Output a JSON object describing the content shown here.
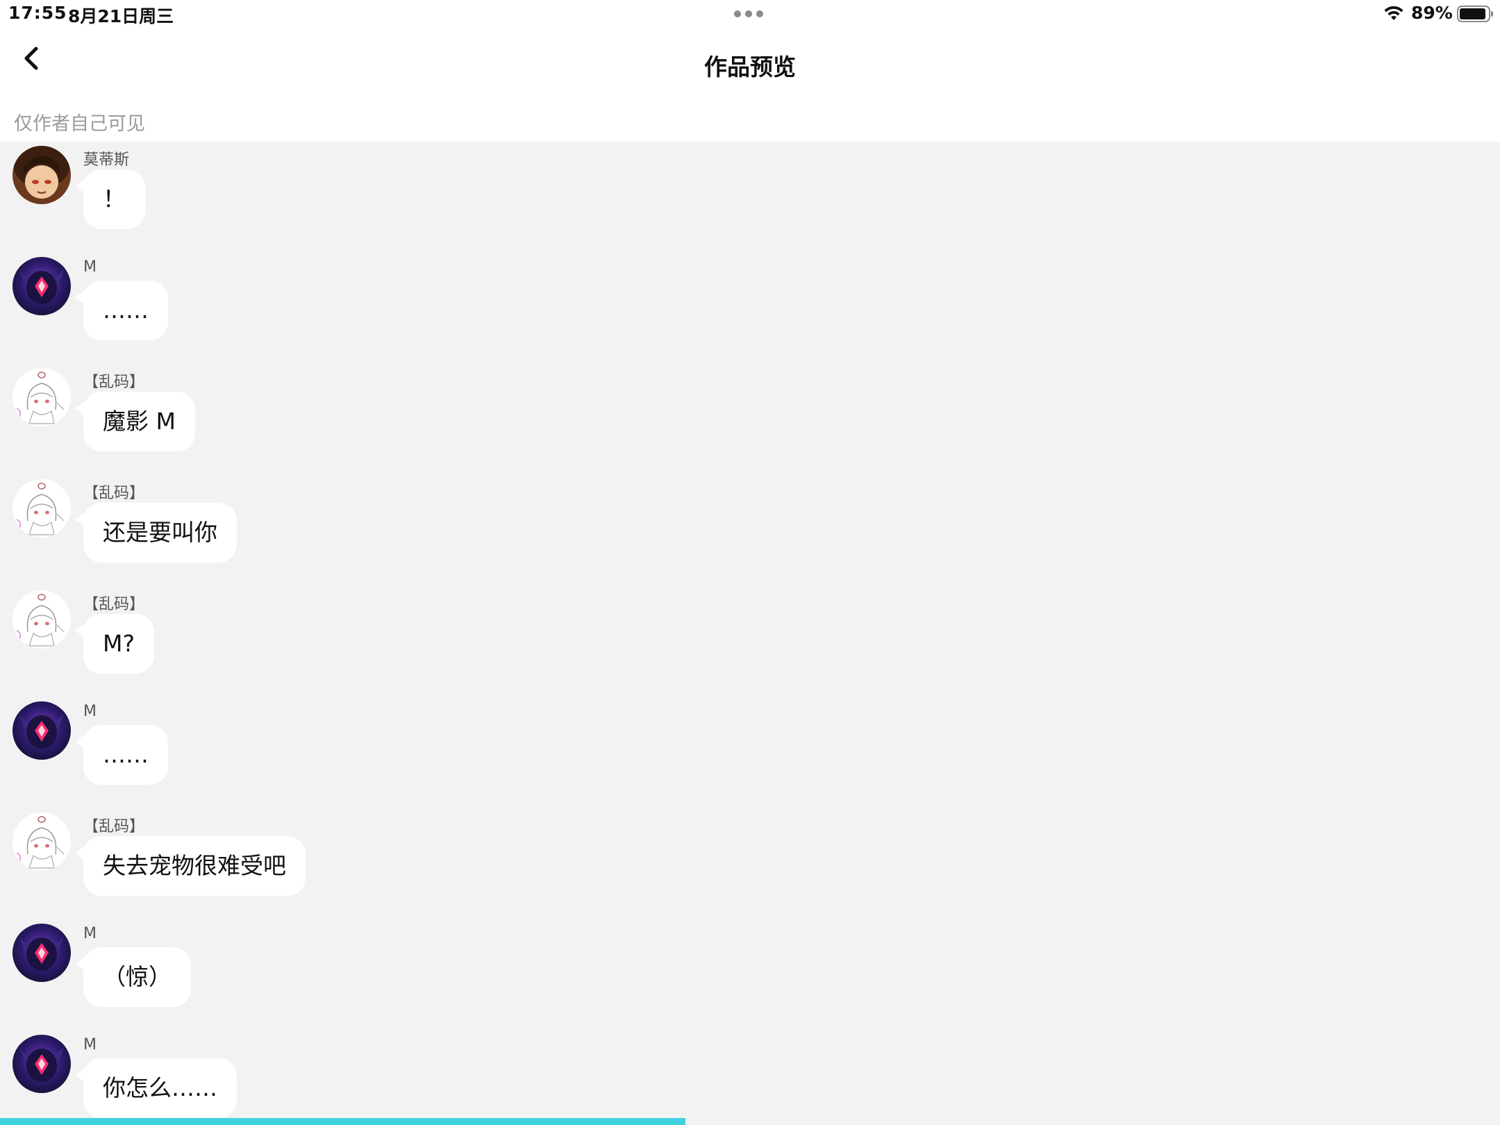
{
  "status_bar": {
    "time": "17:55",
    "date": "8月21日周三",
    "battery": "89%",
    "wifi_icon": "wifi-icon",
    "battery_icon": "battery-icon"
  },
  "nav": {
    "back_icon": "chevron-left-icon",
    "title": "作品预览"
  },
  "visibility_note": "仅作者自己可见",
  "messages": [
    {
      "sender": "莫蒂斯",
      "text": "！",
      "avatar": "mortis"
    },
    {
      "sender": "M",
      "text": "……",
      "avatar": "m"
    },
    {
      "sender": "【乱码】",
      "text": "魔影 M",
      "avatar": "garbled"
    },
    {
      "sender": "【乱码】",
      "text": "还是要叫你",
      "avatar": "garbled"
    },
    {
      "sender": "【乱码】",
      "text": "M?",
      "avatar": "garbled"
    },
    {
      "sender": "M",
      "text": "……",
      "avatar": "m"
    },
    {
      "sender": "【乱码】",
      "text": "失去宠物很难受吧",
      "avatar": "garbled"
    },
    {
      "sender": "M",
      "text": "（惊）",
      "avatar": "m"
    },
    {
      "sender": "M",
      "text": "你怎么……",
      "avatar": "m"
    }
  ],
  "progress": 0.457,
  "colors": {
    "background": "#f2f2f2",
    "bubble": "#ffffff",
    "progress": "#3fd0e0"
  }
}
